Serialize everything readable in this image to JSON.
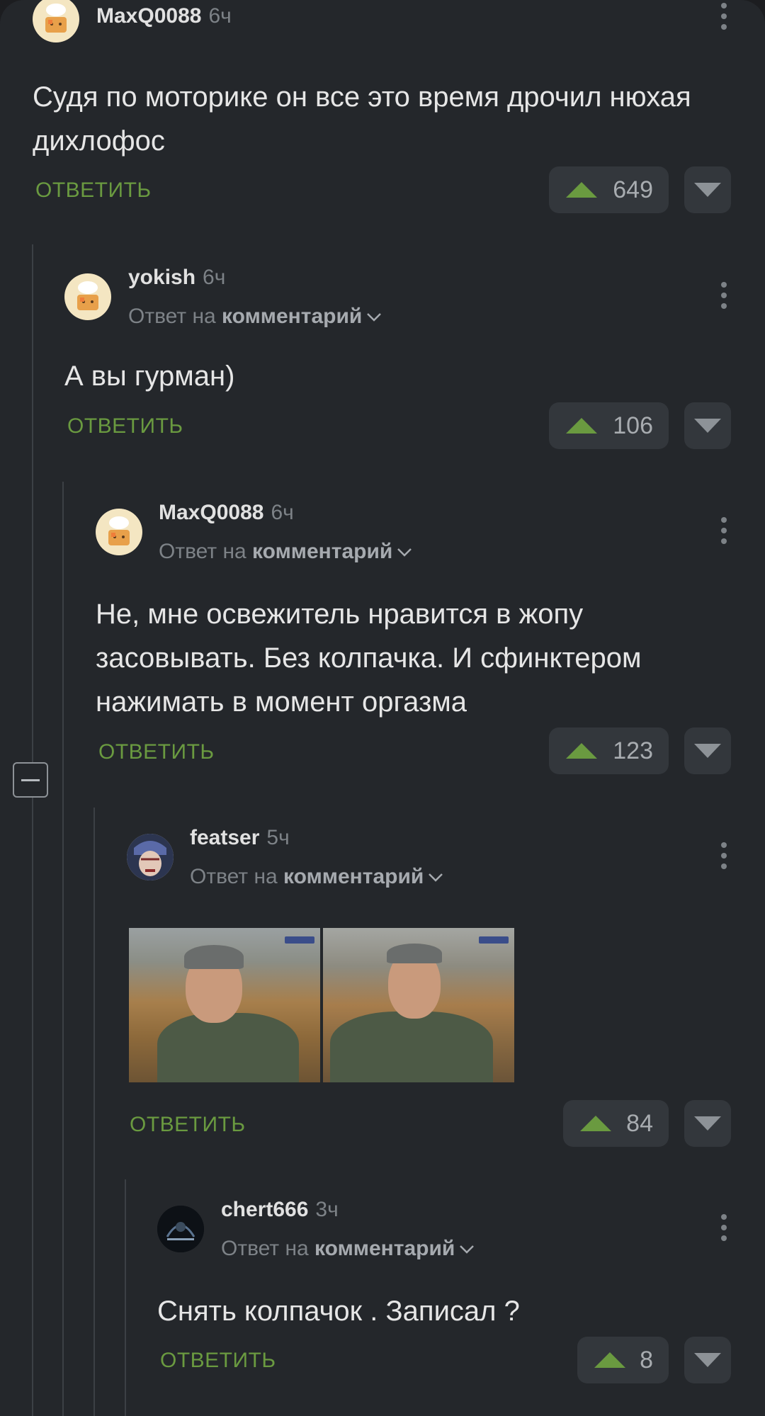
{
  "comments": [
    {
      "username": "MaxQ0088",
      "time": "6ч",
      "text": "Судя по моторике он все это время дрочил нюхая дихлофос",
      "reply_label": "ОТВЕТИТЬ",
      "votes": "649"
    },
    {
      "username": "yokish",
      "time": "6ч",
      "reply_prefix": "Ответ на",
      "reply_target": "комментарий",
      "text": "А вы гурман)",
      "reply_label": "ОТВЕТИТЬ",
      "votes": "106"
    },
    {
      "username": "MaxQ0088",
      "time": "6ч",
      "reply_prefix": "Ответ на",
      "reply_target": "комментарий",
      "text": "Не, мне освежитель нравится в жопу засовывать. Без колпачка. И сфинктером нажимать в момент оргазма",
      "reply_label": "ОТВЕТИТЬ",
      "votes": "123"
    },
    {
      "username": "featser",
      "time": "5ч",
      "reply_prefix": "Ответ на",
      "reply_target": "комментарий",
      "reply_label": "ОТВЕТИТЬ",
      "votes": "84"
    },
    {
      "username": "chert666",
      "time": "3ч",
      "reply_prefix": "Ответ на",
      "reply_target": "комментарий",
      "text": "Снять колпачок . Записал ?",
      "reply_label": "ОТВЕТИТЬ",
      "votes": "8"
    }
  ],
  "icons": {
    "upvote": "triangle-up-icon",
    "downvote": "triangle-down-icon",
    "more": "more-vertical-icon",
    "chevron": "chevron-down-icon",
    "collapse": "minus-icon"
  },
  "colors": {
    "background": "#24272b",
    "accent_green": "#6a9a40",
    "vote_bg": "#33373c"
  }
}
